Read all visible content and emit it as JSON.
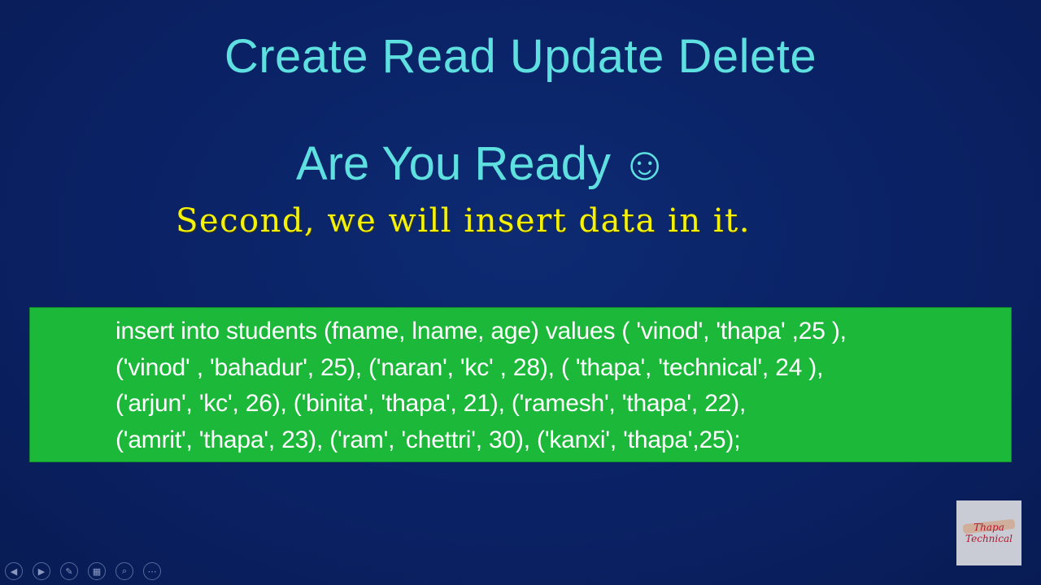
{
  "slide": {
    "title": "Create Read Update Delete",
    "subtitle": "Are You Ready",
    "subtitle_emoji": "☺",
    "step_text": "Second, we will insert data in it.",
    "code_lines": [
      "insert into students (fname, lname, age) values ( 'vinod', 'thapa' ,25 ),",
      "('vinod' , 'bahadur', 25), ('naran', 'kc' , 28), ( 'thapa', 'technical', 24 ),",
      "('arjun', 'kc', 26), ('binita', 'thapa', 21), ('ramesh', 'thapa', 22),",
      "('amrit', 'thapa', 23), ('ram', 'chettri', 30), ('kanxi', 'thapa',25);"
    ]
  },
  "colors": {
    "background": "#0a2163",
    "title": "#5fe0e0",
    "step_text": "#f4f20a",
    "code_box": "#1cb83a",
    "code_text": "#ffffff"
  },
  "presenter_controls": {
    "previous": "◀",
    "next": "▶",
    "pen": "✎",
    "slides": "▦",
    "zoom": "⌕",
    "more": "⋯"
  },
  "logo": {
    "line1": "Thapa",
    "line2": "Technical"
  }
}
